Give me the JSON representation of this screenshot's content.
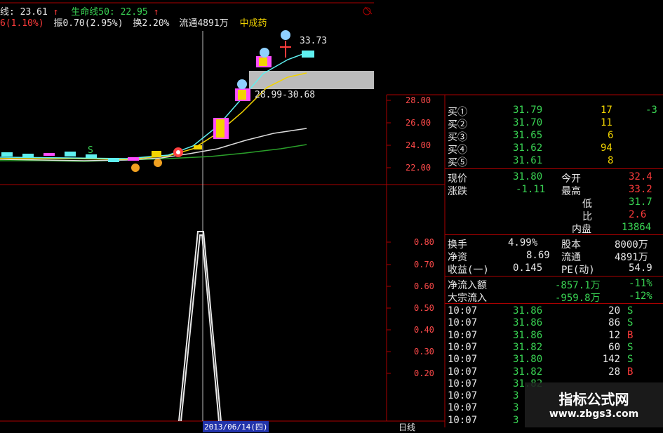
{
  "header": {
    "ma_label": "线: 23.61",
    "life_label": "生命线50: 22.95",
    "change": "6(1.10%)",
    "amplitude": "振0.70(2.95%)",
    "turnover": "换2.20%",
    "float_cap": "流通4891万",
    "sector": "中成药"
  },
  "main_chart": {
    "price_axis": [
      "28.00",
      "26.00",
      "24.00",
      "22.00"
    ],
    "high_label": "33.73",
    "range_label": "28.99-30.68"
  },
  "indicator_chart": {
    "axis": [
      "0.80",
      "0.70",
      "0.60",
      "0.50",
      "0.40",
      "0.30",
      "0.20"
    ],
    "date_label": "2013/06/14(四)",
    "period_label": "日线"
  },
  "orderbook": [
    {
      "label": "买①",
      "price": "31.79",
      "vol": "17",
      "extra": "-3"
    },
    {
      "label": "买②",
      "price": "31.70",
      "vol": "11",
      "extra": ""
    },
    {
      "label": "买③",
      "price": "31.65",
      "vol": "6",
      "extra": ""
    },
    {
      "label": "买④",
      "price": "31.62",
      "vol": "94",
      "extra": ""
    },
    {
      "label": "买⑤",
      "price": "31.61",
      "vol": "8",
      "extra": ""
    }
  ],
  "quote": {
    "price_label": "现价",
    "price": "31.80",
    "open_label": "今开",
    "open": "32.4",
    "chg_label": "涨跌",
    "chg": "-1.11",
    "high_label": "最高",
    "high": "33.2",
    "low_label": "低",
    "low": "31.7",
    "ratio_label": "比",
    "ratio": "2.6",
    "inner_label": "内盘",
    "inner": "13864",
    "turn_label": "换手",
    "turn": "4.99%",
    "cap_label": "股本",
    "cap": "8000万",
    "nav_label": "净资",
    "nav": "8.69",
    "float_label": "流通",
    "float": "4891万",
    "eps_label": "收益(一)",
    "eps": "0.145",
    "pe_label": "PE(动)",
    "pe": "54.9",
    "inflow_label": "净流入额",
    "inflow": "-857.1万",
    "inflow_pct": "-11%",
    "block_label": "大宗流入",
    "block": "-959.8万",
    "block_pct": "-12%"
  },
  "ticks": [
    {
      "time": "10:07",
      "price": "31.86",
      "vol": "20",
      "side": "S"
    },
    {
      "time": "10:07",
      "price": "31.86",
      "vol": "86",
      "side": "S"
    },
    {
      "time": "10:07",
      "price": "31.86",
      "vol": "12",
      "side": "B"
    },
    {
      "time": "10:07",
      "price": "31.82",
      "vol": "60",
      "side": "S"
    },
    {
      "time": "10:07",
      "price": "31.80",
      "vol": "142",
      "side": "S"
    },
    {
      "time": "10:07",
      "price": "31.82",
      "vol": "28",
      "side": "B"
    },
    {
      "time": "10:07",
      "price": "31.82",
      "vol": "",
      "side": ""
    },
    {
      "time": "10:07",
      "price": "3",
      "vol": "",
      "side": ""
    },
    {
      "time": "10:07",
      "price": "3",
      "vol": "",
      "side": ""
    },
    {
      "time": "10:07",
      "price": "3",
      "vol": "",
      "side": ""
    }
  ],
  "watermark": {
    "title": "指标公式网",
    "url": "www.zbgs3.com"
  }
}
